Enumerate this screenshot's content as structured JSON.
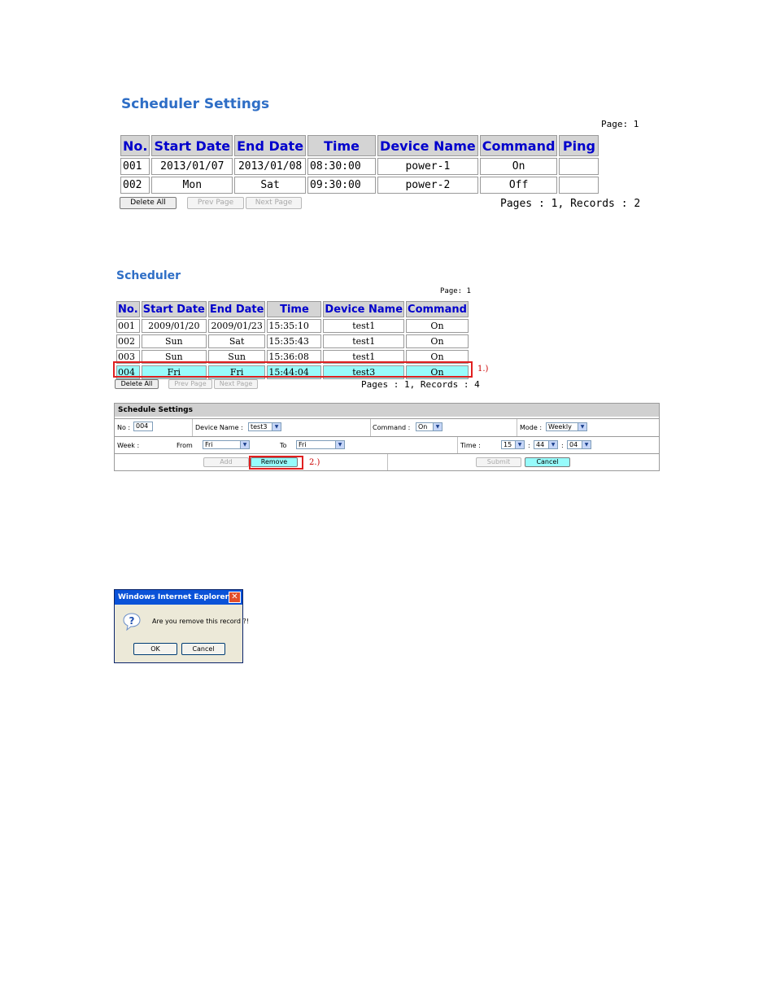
{
  "section1": {
    "title": "Scheduler Settings",
    "page_label": "Page: 1",
    "headers": [
      "No.",
      "Start Date",
      "End Date",
      "Time",
      "Device Name",
      "Command",
      "Ping"
    ],
    "rows": [
      [
        "001",
        "2013/01/07",
        "2013/01/08",
        "08:30:00",
        "power-1",
        "On",
        ""
      ],
      [
        "002",
        "Mon",
        "Sat",
        "09:30:00",
        "power-2",
        "Off",
        ""
      ]
    ],
    "delete_all": "Delete All",
    "prev_page": "Prev Page",
    "next_page": "Next Page",
    "summary": "Pages : 1, Records : 2"
  },
  "section2": {
    "title": "Scheduler",
    "page_label": "Page: 1",
    "headers": [
      "No.",
      "Start Date",
      "End Date",
      "Time",
      "Device Name",
      "Command"
    ],
    "rows": [
      [
        "001",
        "2009/01/20",
        "2009/01/23",
        "15:35:10",
        "test1",
        "On"
      ],
      [
        "002",
        "Sun",
        "Sat",
        "15:35:43",
        "test1",
        "On"
      ],
      [
        "003",
        "Sun",
        "Sun",
        "15:36:08",
        "test1",
        "On"
      ],
      [
        "004",
        "Fri",
        "Fri",
        "15:44:04",
        "test3",
        "On"
      ]
    ],
    "marker1": "1.)",
    "delete_all": "Delete All",
    "prev_page": "Prev Page",
    "next_page": "Next Page",
    "summary": "Pages : 1, Records : 4"
  },
  "settings": {
    "heading": "Schedule Settings",
    "no_label": "No :",
    "no_value": "004",
    "device_label": "Device Name :",
    "device_value": "test3",
    "command_label": "Command :",
    "command_value": "On",
    "mode_label": "Mode :",
    "mode_value": "Weekly",
    "week_label": "Week :",
    "from_label": "From",
    "from_value": "Fri",
    "to_label": "To",
    "to_value": "Fri",
    "time_label": "Time :",
    "hour": "15",
    "minute": "44",
    "second": "04",
    "sep": ":",
    "add": "Add",
    "remove": "Remove",
    "marker2": "2.)",
    "submit": "Submit",
    "cancel": "Cancel"
  },
  "dialog": {
    "title": "Windows Internet Explorer",
    "close_glyph": "✕",
    "message": "Are you remove this record ?!",
    "ok": "OK",
    "cancel": "Cancel"
  },
  "colors": {
    "title_blue": "#2e6ec6",
    "header_text": "#0000cc",
    "selected_row": "#97fbfb",
    "highlight_red": "#e02020"
  }
}
